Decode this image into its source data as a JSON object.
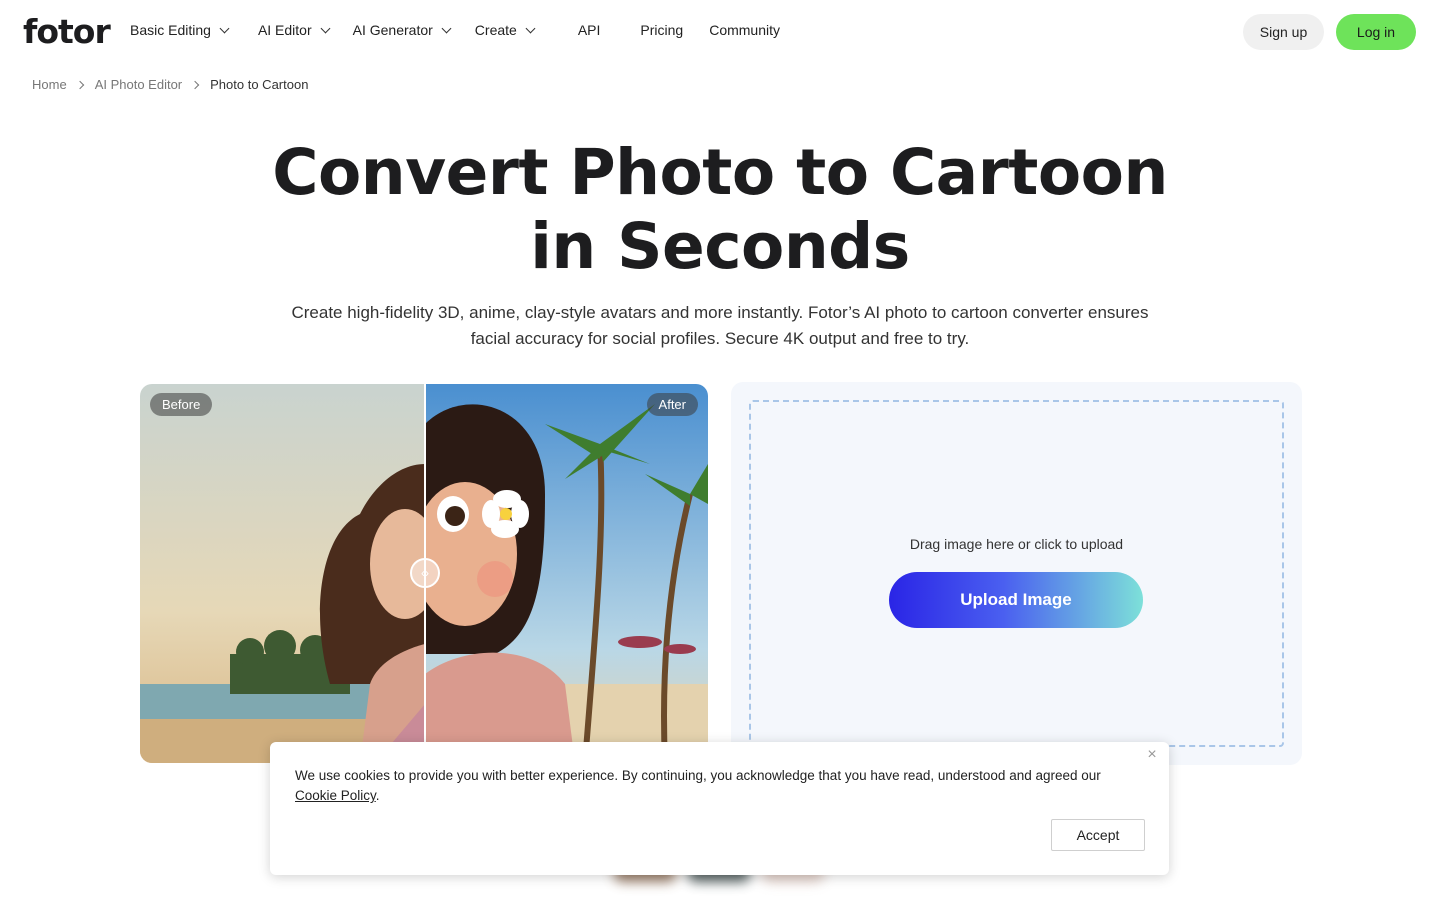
{
  "brand": {
    "logo_text": "fotor",
    "accent_color": "#6ee35a",
    "upload_gradient": [
      "#2a25e6",
      "#7de0d9"
    ]
  },
  "nav": {
    "items": [
      {
        "label": "Basic Editing",
        "has_dropdown": true
      },
      {
        "label": "AI Editor",
        "has_dropdown": true
      },
      {
        "label": "AI Generator",
        "has_dropdown": true
      },
      {
        "label": "Create",
        "has_dropdown": true
      },
      {
        "label": "API",
        "has_dropdown": false
      },
      {
        "label": "Pricing",
        "has_dropdown": false
      },
      {
        "label": "Community",
        "has_dropdown": false
      }
    ],
    "signup_label": "Sign up",
    "login_label": "Log in"
  },
  "breadcrumb": [
    "Home",
    "AI Photo Editor",
    "Photo to Cartoon"
  ],
  "hero": {
    "title": "Convert Photo to Cartoon in Seconds",
    "subtitle": "Create high-fidelity 3D, anime, clay-style avatars and more instantly. Fotor’s AI photo to cartoon converter ensures facial accuracy for social profiles. Secure 4K output and free to try."
  },
  "compare": {
    "before_label": "Before",
    "after_label": "After"
  },
  "upload": {
    "prompt": "Drag image here or click to upload",
    "button_label": "Upload Image"
  },
  "cookie": {
    "text": "We use cookies to provide you with better experience. By continuing, you acknowledge that you have read, understood and agreed our",
    "link_label": "Cookie Policy",
    "text_end": ".",
    "accept_label": "Accept"
  }
}
